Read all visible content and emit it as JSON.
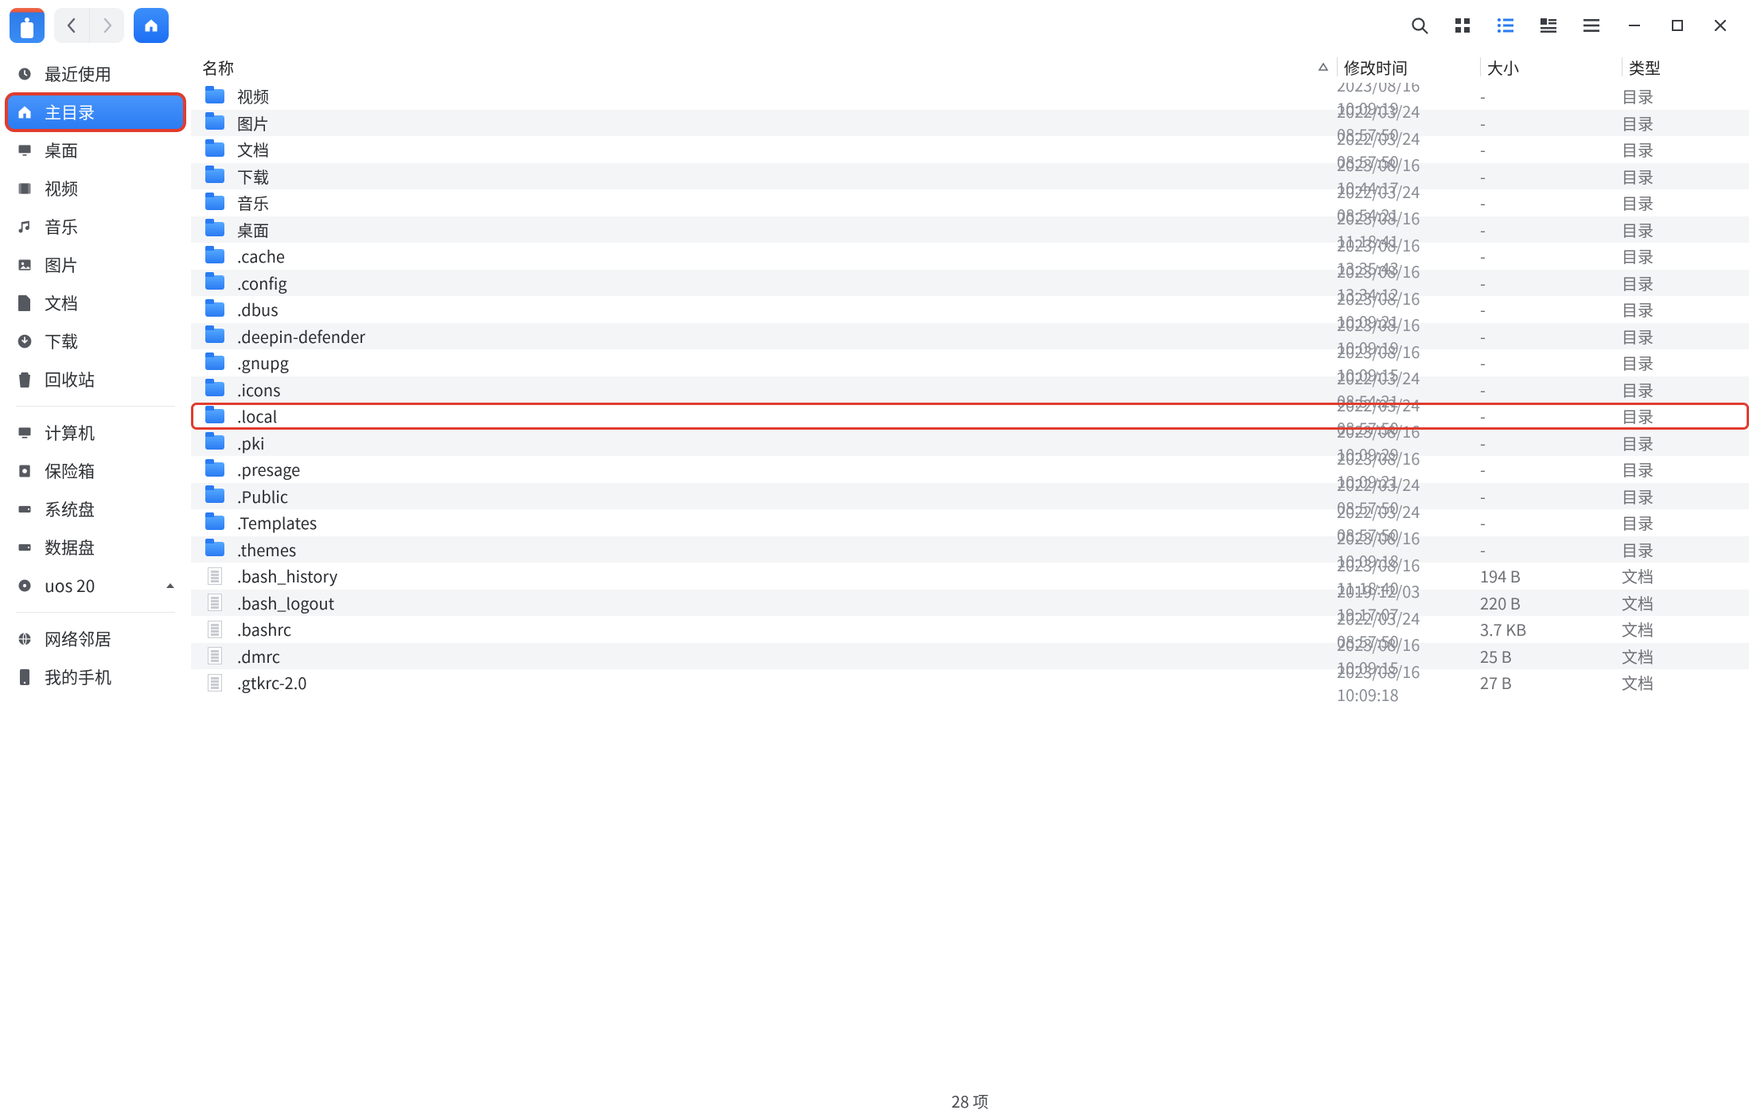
{
  "columns": {
    "name": "名称",
    "mtime": "修改时间",
    "size": "大小",
    "type": "类型"
  },
  "sidebar_groups": [
    [
      {
        "key": "recent",
        "label": "最近使用",
        "icon": "clock"
      },
      {
        "key": "home",
        "label": "主目录",
        "icon": "home",
        "active": true,
        "highlight": true
      },
      {
        "key": "desktop",
        "label": "桌面",
        "icon": "desktop"
      },
      {
        "key": "videos",
        "label": "视频",
        "icon": "film"
      },
      {
        "key": "music",
        "label": "音乐",
        "icon": "music"
      },
      {
        "key": "pictures",
        "label": "图片",
        "icon": "image"
      },
      {
        "key": "documents",
        "label": "文档",
        "icon": "doc"
      },
      {
        "key": "downloads",
        "label": "下载",
        "icon": "download"
      },
      {
        "key": "trash",
        "label": "回收站",
        "icon": "trash"
      }
    ],
    [
      {
        "key": "computer",
        "label": "计算机",
        "icon": "monitor"
      },
      {
        "key": "safe",
        "label": "保险箱",
        "icon": "safe"
      },
      {
        "key": "sysdisk",
        "label": "系统盘",
        "icon": "hdd"
      },
      {
        "key": "datadisk",
        "label": "数据盘",
        "icon": "hdd"
      },
      {
        "key": "uos20",
        "label": "uos 20",
        "icon": "disc",
        "expand": true
      }
    ],
    [
      {
        "key": "network",
        "label": "网络邻居",
        "icon": "globe"
      },
      {
        "key": "phone",
        "label": "我的手机",
        "icon": "phone"
      }
    ]
  ],
  "files": [
    {
      "name": "视频",
      "mtime": "2023/08/16 10:09:19",
      "size": "-",
      "type": "目录",
      "kind": "folder"
    },
    {
      "name": "图片",
      "mtime": "2022/03/24 08:57:50",
      "size": "-",
      "type": "目录",
      "kind": "folder"
    },
    {
      "name": "文档",
      "mtime": "2022/03/24 08:57:50",
      "size": "-",
      "type": "目录",
      "kind": "folder"
    },
    {
      "name": "下载",
      "mtime": "2023/08/16 10:44:17",
      "size": "-",
      "type": "目录",
      "kind": "folder"
    },
    {
      "name": "音乐",
      "mtime": "2022/03/24 08:54:21",
      "size": "-",
      "type": "目录",
      "kind": "folder"
    },
    {
      "name": "桌面",
      "mtime": "2023/08/16 11:18:41",
      "size": "-",
      "type": "目录",
      "kind": "folder"
    },
    {
      "name": ".cache",
      "mtime": "2023/08/16 13:35:43",
      "size": "-",
      "type": "目录",
      "kind": "folder"
    },
    {
      "name": ".config",
      "mtime": "2023/08/16 13:34:12",
      "size": "-",
      "type": "目录",
      "kind": "folder"
    },
    {
      "name": ".dbus",
      "mtime": "2023/08/16 10:09:21",
      "size": "-",
      "type": "目录",
      "kind": "folder"
    },
    {
      "name": ".deepin-defender",
      "mtime": "2023/08/16 10:09:19",
      "size": "-",
      "type": "目录",
      "kind": "folder"
    },
    {
      "name": ".gnupg",
      "mtime": "2023/08/16 10:09:15",
      "size": "-",
      "type": "目录",
      "kind": "folder"
    },
    {
      "name": ".icons",
      "mtime": "2022/03/24 08:54:21",
      "size": "-",
      "type": "目录",
      "kind": "folder"
    },
    {
      "name": ".local",
      "mtime": "2022/03/24 08:57:50",
      "size": "-",
      "type": "目录",
      "kind": "folder",
      "highlight": true
    },
    {
      "name": ".pki",
      "mtime": "2023/08/16 10:09:29",
      "size": "-",
      "type": "目录",
      "kind": "folder"
    },
    {
      "name": ".presage",
      "mtime": "2023/08/16 10:09:21",
      "size": "-",
      "type": "目录",
      "kind": "folder"
    },
    {
      "name": ".Public",
      "mtime": "2022/03/24 08:57:50",
      "size": "-",
      "type": "目录",
      "kind": "folder"
    },
    {
      "name": ".Templates",
      "mtime": "2022/03/24 08:57:50",
      "size": "-",
      "type": "目录",
      "kind": "folder"
    },
    {
      "name": ".themes",
      "mtime": "2023/08/16 10:09:18",
      "size": "-",
      "type": "目录",
      "kind": "folder"
    },
    {
      "name": ".bash_history",
      "mtime": "2023/08/16 11:18:40",
      "size": "194 B",
      "type": "文档",
      "kind": "doc"
    },
    {
      "name": ".bash_logout",
      "mtime": "2019/12/03 19:17:07",
      "size": "220 B",
      "type": "文档",
      "kind": "doc"
    },
    {
      "name": ".bashrc",
      "mtime": "2022/03/24 08:57:50",
      "size": "3.7 KB",
      "type": "文档",
      "kind": "doc"
    },
    {
      "name": ".dmrc",
      "mtime": "2023/08/16 10:09:15",
      "size": "25 B",
      "type": "文档",
      "kind": "doc"
    },
    {
      "name": ".gtkrc-2.0",
      "mtime": "2023/08/16 10:09:18",
      "size": "27 B",
      "type": "文档",
      "kind": "doc"
    }
  ],
  "status": "28 项"
}
